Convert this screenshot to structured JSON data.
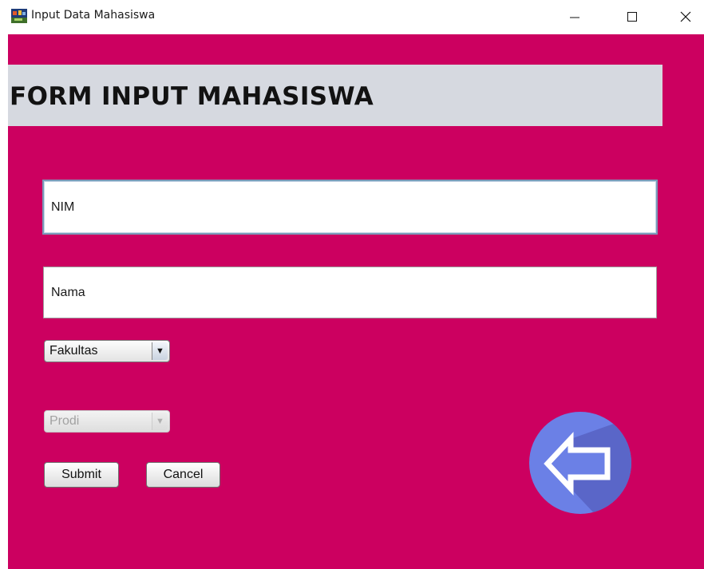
{
  "window": {
    "title": "Input Data Mahasiswa",
    "icon": "java-app-icon"
  },
  "header": {
    "title": "FORM INPUT MAHASISWA"
  },
  "form": {
    "nim_value": "NIM",
    "nama_value": "Nama",
    "fakultas_selected": "Fakultas",
    "fakultas_arrow": "▼",
    "prodi_selected": "Prodi",
    "prodi_arrow": "▼",
    "prodi_enabled": false,
    "submit_label": "Submit",
    "cancel_label": "Cancel"
  },
  "colors": {
    "background": "#cc0060",
    "header_band": "#d6d9e0",
    "back_circle": "#6b80e6",
    "back_circle_shadow": "#5a66c8"
  },
  "icons": {
    "back": "back-arrow-icon",
    "minimize": "minimize-icon",
    "maximize": "maximize-icon",
    "close": "close-icon"
  }
}
